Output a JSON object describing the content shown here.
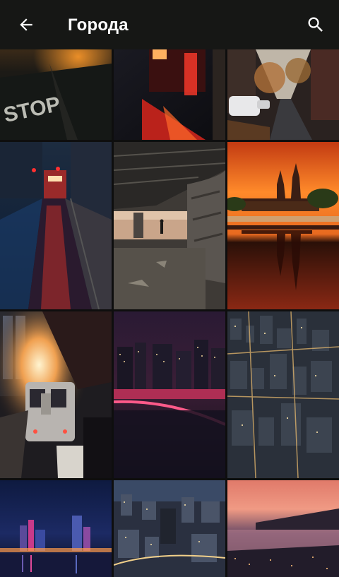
{
  "app_bar": {
    "title": "Города",
    "back_icon": "arrow-back-icon",
    "search_icon": "search-icon",
    "background": "#161715"
  },
  "gallery": {
    "photos": [
      {
        "id": "stop-road-night"
      },
      {
        "id": "neon-wet-street"
      },
      {
        "id": "autumn-street-cars"
      },
      {
        "id": "night-tram-red-lights"
      },
      {
        "id": "concrete-tunnel-silhouette"
      },
      {
        "id": "cathedral-sunset-reflection"
      },
      {
        "id": "train-platform-sunset"
      },
      {
        "id": "skyline-purple-dusk"
      },
      {
        "id": "aerial-city-night"
      },
      {
        "id": "waterfront-skyline-night"
      },
      {
        "id": "aerial-city-dusk"
      },
      {
        "id": "coastal-city-pink-sky"
      }
    ]
  }
}
